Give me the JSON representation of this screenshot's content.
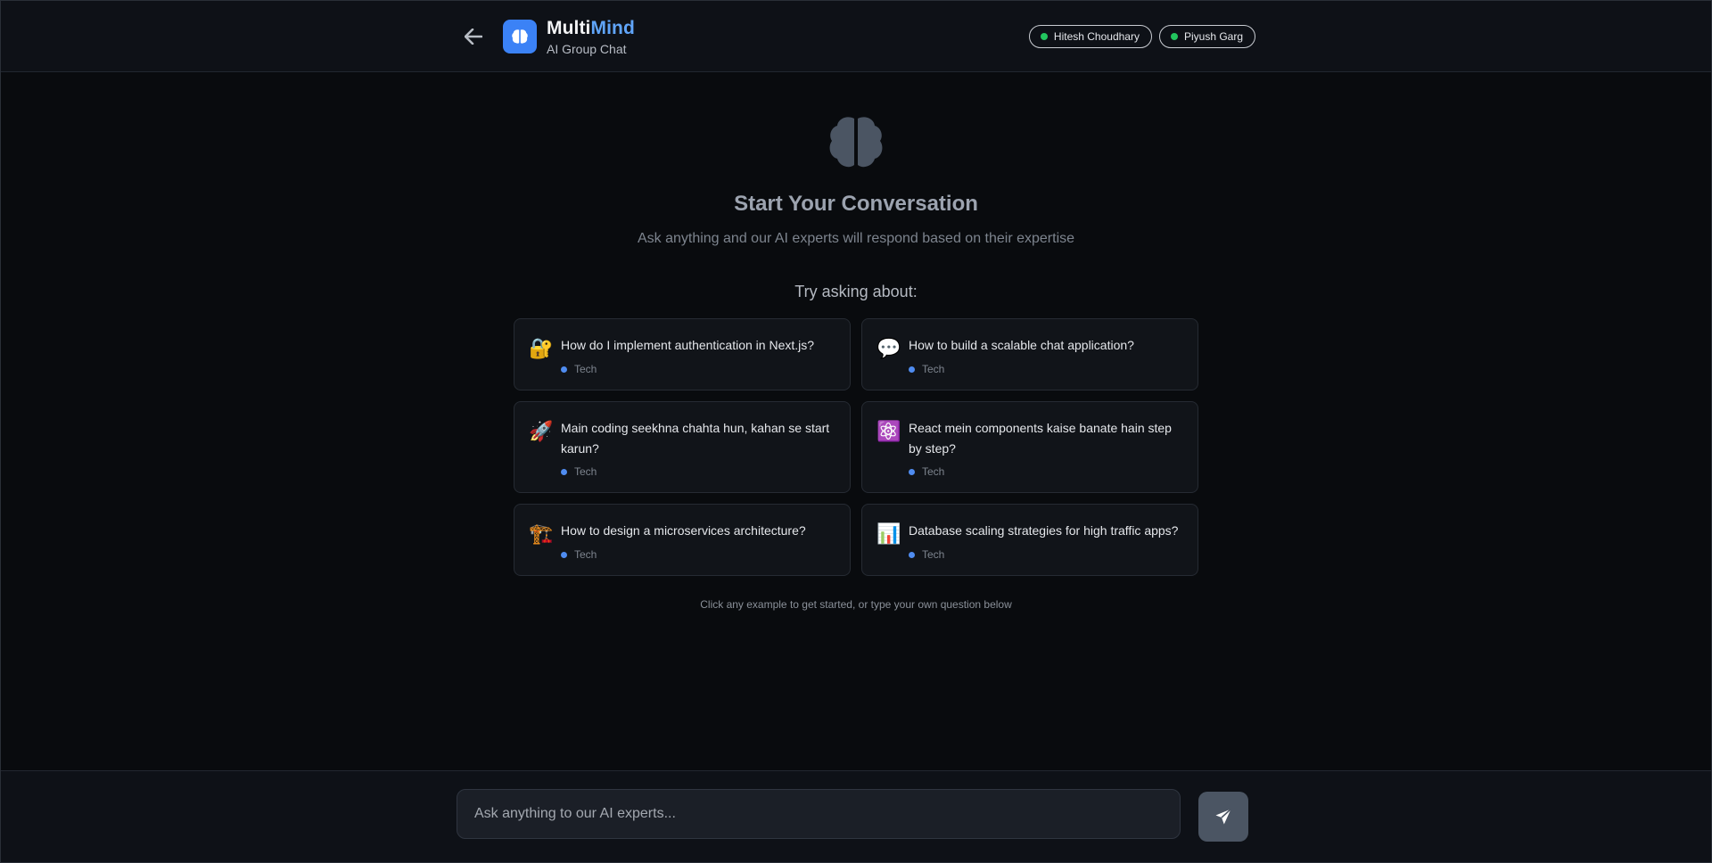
{
  "header": {
    "brand_part1": "Multi",
    "brand_part2": "Mind",
    "subtitle": "AI Group Chat",
    "participants": [
      {
        "name": "Hitesh Choudhary",
        "status_color": "#22c55e"
      },
      {
        "name": "Piyush Garg",
        "status_color": "#22c55e"
      }
    ],
    "icons": {
      "back": "arrow-left-icon",
      "logo": "brain-icon"
    }
  },
  "main": {
    "icon": "brain-icon",
    "title": "Start Your Conversation",
    "description": "Ask anything and our AI experts will respond based on their expertise",
    "try_label": "Try asking about:",
    "examples": [
      {
        "emoji": "🔐",
        "icon": "lock-with-key-icon",
        "question": "How do I implement authentication in Next.js?",
        "tag": "Tech"
      },
      {
        "emoji": "💬",
        "icon": "speech-bubble-icon",
        "question": "How to build a scalable chat application?",
        "tag": "Tech"
      },
      {
        "emoji": "🚀",
        "icon": "rocket-icon",
        "question": "Main coding seekhna chahta hun, kahan se start karun?",
        "tag": "Tech"
      },
      {
        "emoji": "⚛️",
        "icon": "atom-icon",
        "question": "React mein components kaise banate hain step by step?",
        "tag": "Tech"
      },
      {
        "emoji": "🏗️",
        "icon": "construction-crane-icon",
        "question": "How to design a microservices architecture?",
        "tag": "Tech"
      },
      {
        "emoji": "📊",
        "icon": "bar-chart-icon",
        "question": "Database scaling strategies for high traffic apps?",
        "tag": "Tech"
      }
    ],
    "hint": "Click any example to get started, or type your own question below"
  },
  "composer": {
    "placeholder": "Ask anything to our AI experts...",
    "value": "",
    "send_icon": "paper-plane-icon"
  },
  "colors": {
    "accent": "#3b82f6",
    "accent_text": "#60a5fa",
    "online": "#22c55e",
    "tag_dot": "#4f8cf0"
  }
}
